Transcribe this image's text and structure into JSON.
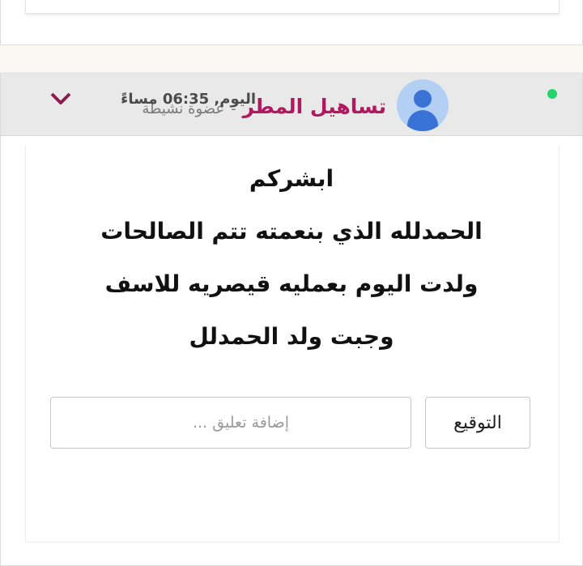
{
  "post": {
    "author": "تساهيل المطر",
    "separator": "-",
    "role": "عضوة نشيطة",
    "timestamp": "اليوم, 06:35 مساءً",
    "message_lines": [
      "ابشركم",
      "الحمدلله الذي بنعمته تتم الصالحات",
      "ولدت اليوم بعمليه قيصريه للاسف",
      "وجبت ولد الحمدلل"
    ],
    "signature_button": "التوقيع",
    "comment_placeholder": "إضافة تعليق ..."
  },
  "colors": {
    "username": "#b0185f",
    "online": "#22d46b",
    "chevron": "#8b1d4e",
    "avatar_bg": "#b3d0f4",
    "avatar_fg": "#3a72d6"
  },
  "icons": [
    "online-status-icon",
    "avatar-icon",
    "chevron-down-icon"
  ]
}
